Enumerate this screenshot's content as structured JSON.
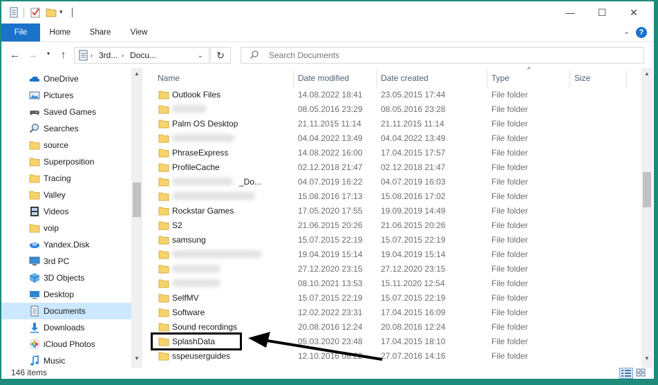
{
  "window": {
    "controls": {
      "minimize": "—",
      "maximize": "☐",
      "close": "✕"
    }
  },
  "ribbon": {
    "tabs": [
      "File",
      "Home",
      "Share",
      "View"
    ],
    "expand": "⌄",
    "help": "?"
  },
  "address": {
    "crumbs": [
      "3rd...",
      "Docu..."
    ],
    "search_placeholder": "Search Documents"
  },
  "nav_pane": {
    "items": [
      {
        "label": "OneDrive",
        "icon": "onedrive-icon"
      },
      {
        "label": "Pictures",
        "icon": "pictures-icon"
      },
      {
        "label": "Saved Games",
        "icon": "saved-games-icon"
      },
      {
        "label": "Searches",
        "icon": "searches-icon"
      },
      {
        "label": "source",
        "icon": "folder-icon"
      },
      {
        "label": "Superposition",
        "icon": "folder-icon"
      },
      {
        "label": "Tracing",
        "icon": "folder-icon"
      },
      {
        "label": "Valley",
        "icon": "folder-icon"
      },
      {
        "label": "Videos",
        "icon": "videos-icon"
      },
      {
        "label": "voip",
        "icon": "folder-icon"
      },
      {
        "label": "Yandex.Disk",
        "icon": "yandex-disk-icon"
      },
      {
        "label": "3rd PC",
        "icon": "pc-icon"
      },
      {
        "label": "3D Objects",
        "icon": "3d-objects-icon"
      },
      {
        "label": "Desktop",
        "icon": "desktop-icon"
      },
      {
        "label": "Documents",
        "icon": "documents-icon",
        "selected": true
      },
      {
        "label": "Downloads",
        "icon": "downloads-icon"
      },
      {
        "label": "iCloud Photos",
        "icon": "icloud-photos-icon"
      },
      {
        "label": "Music",
        "icon": "music-icon"
      }
    ]
  },
  "file_list": {
    "columns": [
      "Name",
      "Date modified",
      "Date created",
      "Type",
      "Size"
    ],
    "sort_indicator": "^",
    "rows": [
      {
        "name": "Outlook Files",
        "modified": "14.08.2022 18:41",
        "created": "23.05.2015 17:44",
        "type": "File folder"
      },
      {
        "name": "",
        "blurred": true,
        "modified": "08.05.2016 23:29",
        "created": "08.05.2016 23:28",
        "type": "File folder"
      },
      {
        "name": "Palm OS Desktop",
        "modified": "21.11.2015 11:14",
        "created": "21.11.2015 11:14",
        "type": "File folder"
      },
      {
        "name": "",
        "blurred": true,
        "modified": "04.04.2022 13:49",
        "created": "04.04.2022 13:49",
        "type": "File folder"
      },
      {
        "name": "PhraseExpress",
        "modified": "14.08.2022 16:00",
        "created": "17.04.2015 17:57",
        "type": "File folder"
      },
      {
        "name": "ProfileCache",
        "modified": "02.12.2018 21:47",
        "created": "02.12.2018 21:47",
        "type": "File folder"
      },
      {
        "name": "_Do...",
        "blurred": true,
        "modified": "04.07.2019 16:22",
        "created": "04.07.2019 16:03",
        "type": "File folder"
      },
      {
        "name": "",
        "blurred": true,
        "modified": "15.08.2016 17:13",
        "created": "15.08.2016 17:02",
        "type": "File folder"
      },
      {
        "name": "Rockstar Games",
        "modified": "17.05.2020 17:55",
        "created": "19.09.2019 14:49",
        "type": "File folder"
      },
      {
        "name": "S2",
        "modified": "21.06.2015 20:26",
        "created": "21.06.2015 20:26",
        "type": "File folder"
      },
      {
        "name": "samsung",
        "modified": "15.07.2015 22:19",
        "created": "15.07.2015 22:19",
        "type": "File folder"
      },
      {
        "name": "",
        "blurred": true,
        "modified": "19.04.2019 15:14",
        "created": "19.04.2019 15:14",
        "type": "File folder"
      },
      {
        "name": "",
        "blurred": true,
        "modified": "27.12.2020 23:15",
        "created": "27.12.2020 23:15",
        "type": "File folder"
      },
      {
        "name": "",
        "blurred": true,
        "modified": "08.10.2021 13:53",
        "created": "15.11.2020 12:54",
        "type": "File folder"
      },
      {
        "name": "SelfMV",
        "modified": "15.07.2015 22:19",
        "created": "15.07.2015 22:19",
        "type": "File folder"
      },
      {
        "name": "Software",
        "modified": "12.02.2022 23:31",
        "created": "17.04.2015 16:09",
        "type": "File folder"
      },
      {
        "name": "Sound recordings",
        "modified": "20.08.2016 12:24",
        "created": "20.08.2016 12:24",
        "type": "File folder"
      },
      {
        "name": "SplashData",
        "modified": "05.03.2020 23:48",
        "created": "17.04.2015 18:10",
        "type": "File folder",
        "highlighted": true
      },
      {
        "name": "sspeuserguides",
        "modified": "12.10.2016 08:22",
        "created": "27.07.2016 14:16",
        "type": "File folder"
      }
    ]
  },
  "status": {
    "item_count": "146 items"
  },
  "colors": {
    "accent": "#1a73c9",
    "selection": "#cce8ff",
    "folder": "#f7d36b",
    "background": "#1d8a7a"
  }
}
